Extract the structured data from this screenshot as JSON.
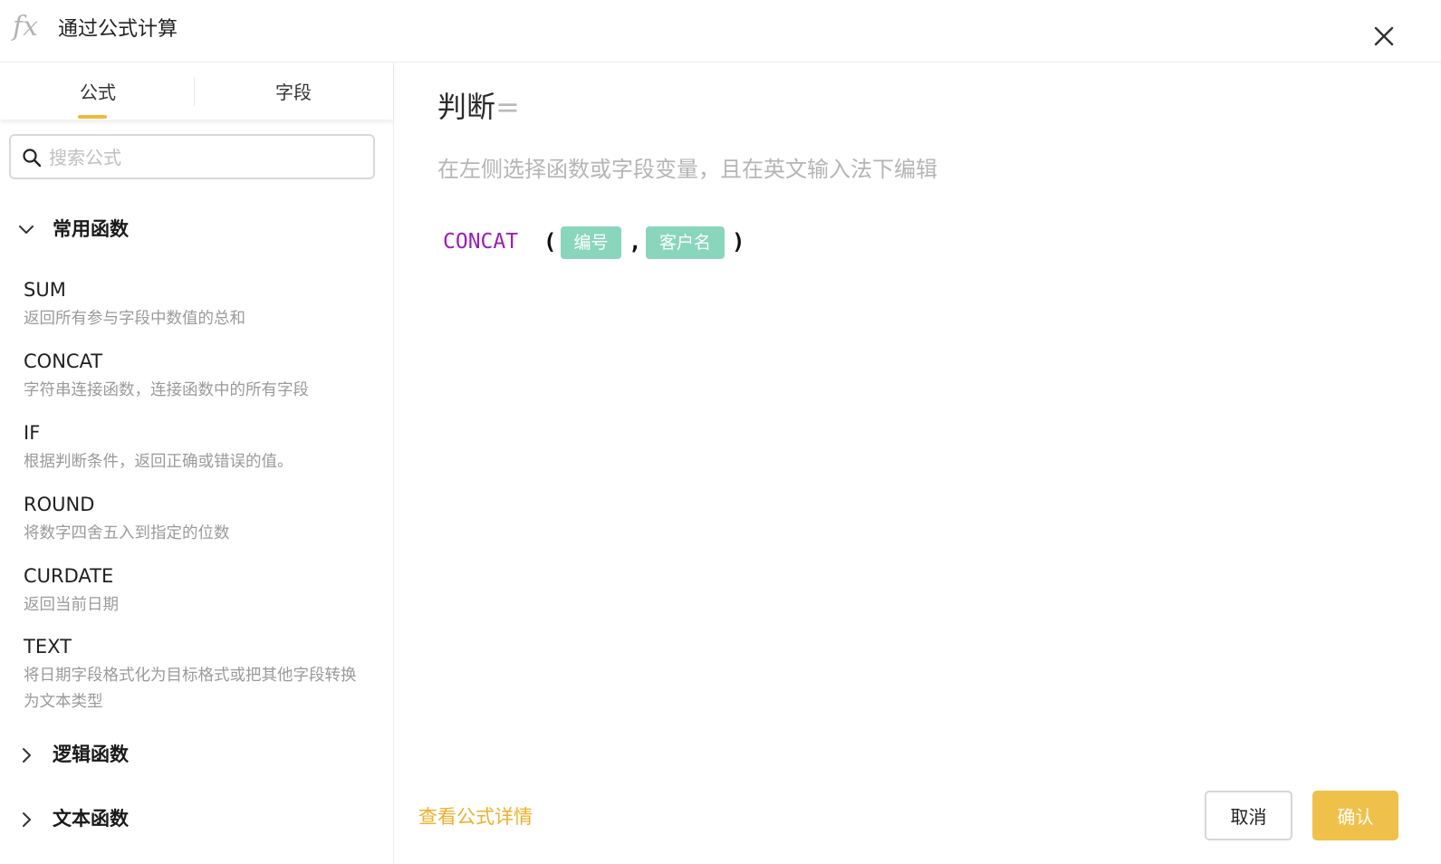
{
  "header": {
    "fx_symbol": "fx",
    "title": "通过公式计算",
    "close_icon": "close-icon"
  },
  "left_panel": {
    "tabs": [
      {
        "label": "公式",
        "active": true
      },
      {
        "label": "字段",
        "active": false
      }
    ],
    "search": {
      "placeholder": "搜索公式",
      "value": ""
    },
    "groups": [
      {
        "label": "常用函数",
        "expanded": true,
        "items": [
          {
            "name": "SUM",
            "desc": "返回所有参与字段中数值的总和"
          },
          {
            "name": "CONCAT",
            "desc": "字符串连接函数，连接函数中的所有字段"
          },
          {
            "name": "IF",
            "desc": "根据判断条件，返回正确或错误的值。"
          },
          {
            "name": "ROUND",
            "desc": "将数字四舍五入到指定的位数"
          },
          {
            "name": "CURDATE",
            "desc": "返回当前日期"
          },
          {
            "name": "TEXT",
            "desc": "将日期字段格式化为目标格式或把其他字段转换为文本类型"
          }
        ]
      },
      {
        "label": "逻辑函数",
        "expanded": false
      },
      {
        "label": "文本函数",
        "expanded": false
      }
    ]
  },
  "editor": {
    "field_name": "判断",
    "equals": "=",
    "hint": "在左侧选择函数或字段变量，且在英文输入法下编辑",
    "expression": {
      "function": "CONCAT",
      "open_paren": "(",
      "args": [
        "编号",
        "客户名"
      ],
      "separator": ",",
      "close_paren": ")"
    }
  },
  "footer": {
    "detail_link": "查看公式详情",
    "cancel_label": "取消",
    "confirm_label": "确认"
  },
  "colors": {
    "accent": "#f0b93a",
    "function_name": "#9a1fb5",
    "field_tag_bg": "#8ad6bd",
    "confirm_bg": "#efc14a"
  }
}
